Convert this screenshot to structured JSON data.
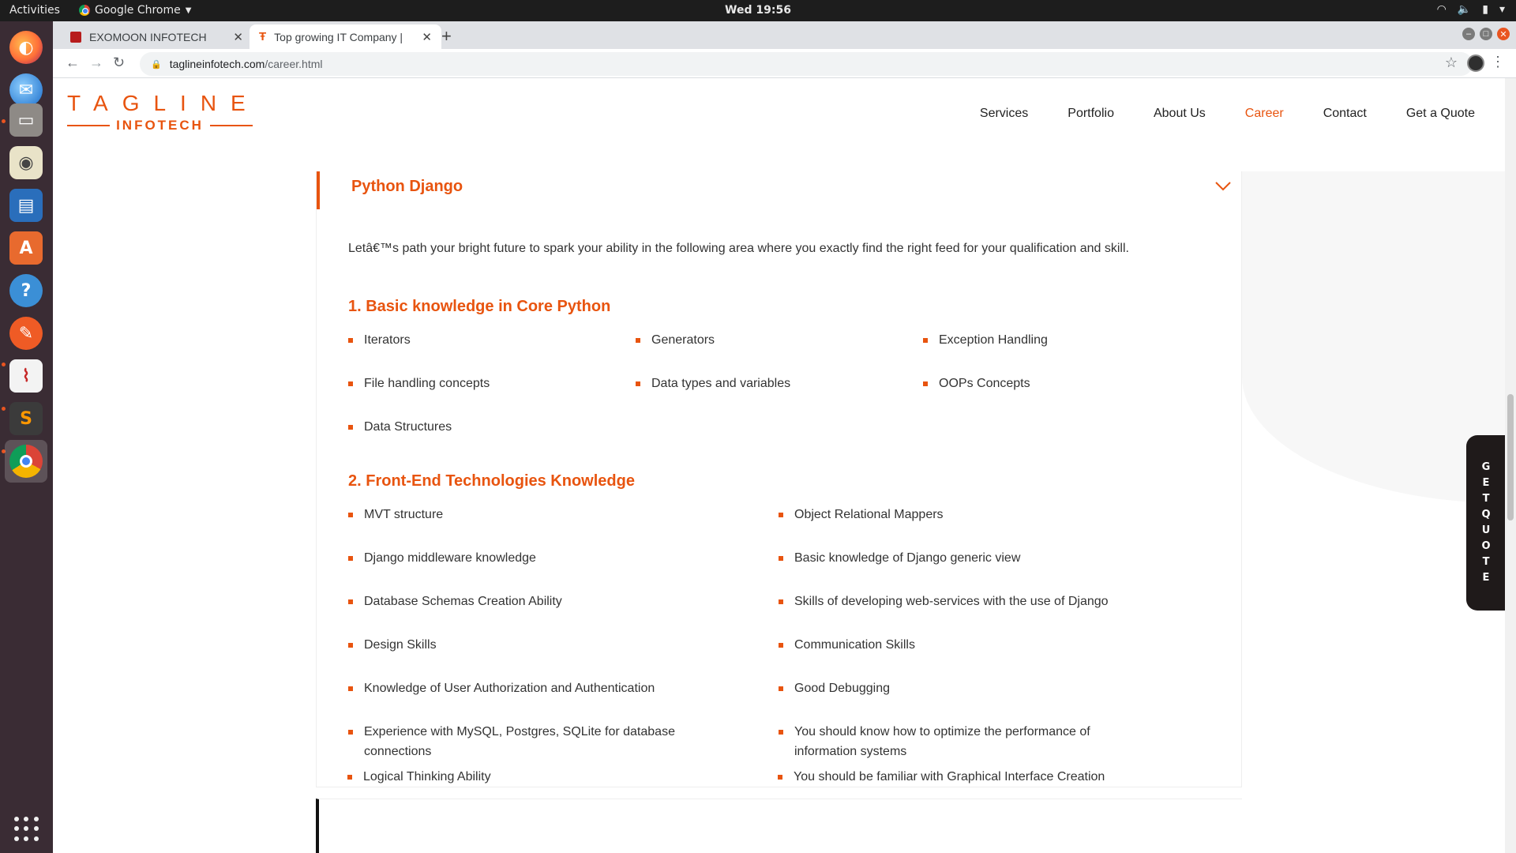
{
  "os": {
    "activities": "Activities",
    "app_menu": "Google Chrome",
    "clock": "Wed 19:56"
  },
  "browser": {
    "tabs": [
      {
        "title": "EXOMOON INFOTECH",
        "active": false
      },
      {
        "title": "Top growing IT Company | ",
        "active": true
      }
    ],
    "url_domain": "taglineinfotech.com",
    "url_path": "/career.html"
  },
  "site": {
    "logo_top": "TAGLINE",
    "logo_bottom": "INFOTECH",
    "nav": [
      "Services",
      "Portfolio",
      "About Us",
      "Career",
      "Contact",
      "Get a Quote"
    ],
    "current_nav": "Career"
  },
  "job": {
    "title": "Python Django",
    "intro": "Letâ€™s path your bright future to spark your ability in the following area where you exactly find the right feed for your qualification and skill.",
    "sections": [
      {
        "title": "1. Basic knowledge in Core Python",
        "items": [
          "Iterators",
          "Generators",
          "Exception Handling",
          "File handling concepts",
          "Data types and variables",
          "OOPs Concepts",
          "Data Structures"
        ]
      },
      {
        "title": "2. Front-End Technologies Knowledge",
        "items": [
          "MVT structure",
          "Object Relational Mappers",
          "Django middleware knowledge",
          "Basic knowledge of Django generic view",
          "Database Schemas Creation Ability",
          "Skills of developing web-services with the use of Django",
          "Design Skills",
          "Communication Skills",
          "Knowledge of User Authorization and Authentication",
          "Good Debugging",
          "Experience with MySQL, Postgres, SQLite for database connections",
          "You should know how to optimize the performance of information systems",
          "Logical Thinking Ability",
          "You should be familiar with Graphical Interface Creation"
        ]
      }
    ]
  },
  "quote_tab": "GETQUOTE",
  "colors": {
    "accent": "#e8540f",
    "dock": "#3a2c34",
    "topbar": "#1d1d1d"
  }
}
